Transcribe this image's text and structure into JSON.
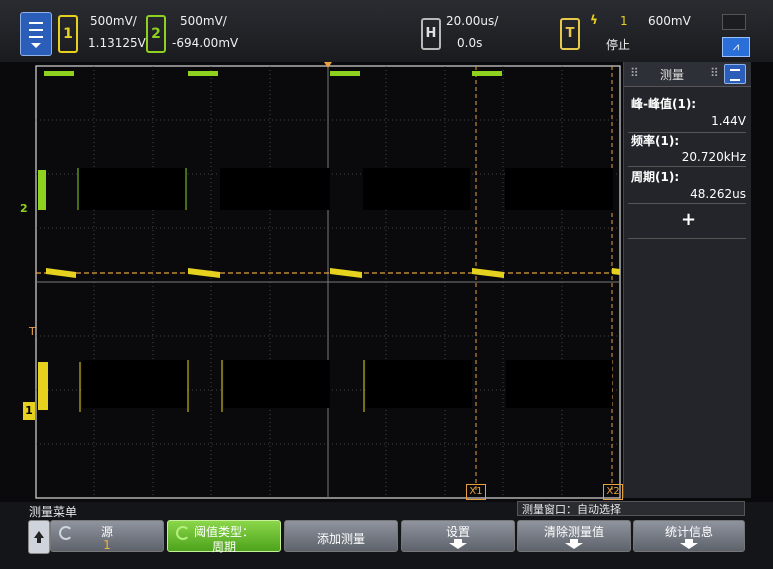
{
  "colors": {
    "ch1": "#e6d21e",
    "ch2": "#8fd11f",
    "trigger": "#e8a040",
    "accent": "#2a5eb8"
  },
  "topbar": {
    "menu_icon": "menu-icon",
    "ch1": {
      "number": "1",
      "scale": "500mV/",
      "offset": "1.13125V"
    },
    "ch2": {
      "number": "2",
      "scale": "500mV/",
      "offset": "-694.00mV"
    },
    "horizontal": {
      "label": "H",
      "scale": "20.00us/",
      "delay": "0.0s"
    },
    "trigger": {
      "label": "T",
      "edge_icon": "rising-edge-icon",
      "source": "1",
      "level": "600mV",
      "status": "停止"
    },
    "edge_button_icon": "trigger-edge-icon"
  },
  "waveform_markers": {
    "ch2_marker": "2",
    "trig_marker": "T",
    "ch1_marker": "1",
    "cursor_x1": "X1",
    "cursor_x2": "X2"
  },
  "measure_panel": {
    "title": "测量",
    "items": [
      {
        "label": "峰-峰值(1):",
        "value": "1.44V"
      },
      {
        "label": "频率(1):",
        "value": "20.720kHz"
      },
      {
        "label": "周期(1):",
        "value": "48.262us"
      }
    ],
    "add_label": "+"
  },
  "status": {
    "menu_name": "测量菜单",
    "window_info": "测量窗口：自动选择"
  },
  "softkeys": [
    {
      "line1": "源",
      "line2": "1"
    },
    {
      "line1": "阈值类型：",
      "line2": "周期"
    },
    {
      "line1": "添加测量",
      "line2": ""
    },
    {
      "line1": "设置",
      "line2": ""
    },
    {
      "line1": "清除测量值",
      "line2": ""
    },
    {
      "line1": "统计信息",
      "line2": ""
    }
  ]
}
